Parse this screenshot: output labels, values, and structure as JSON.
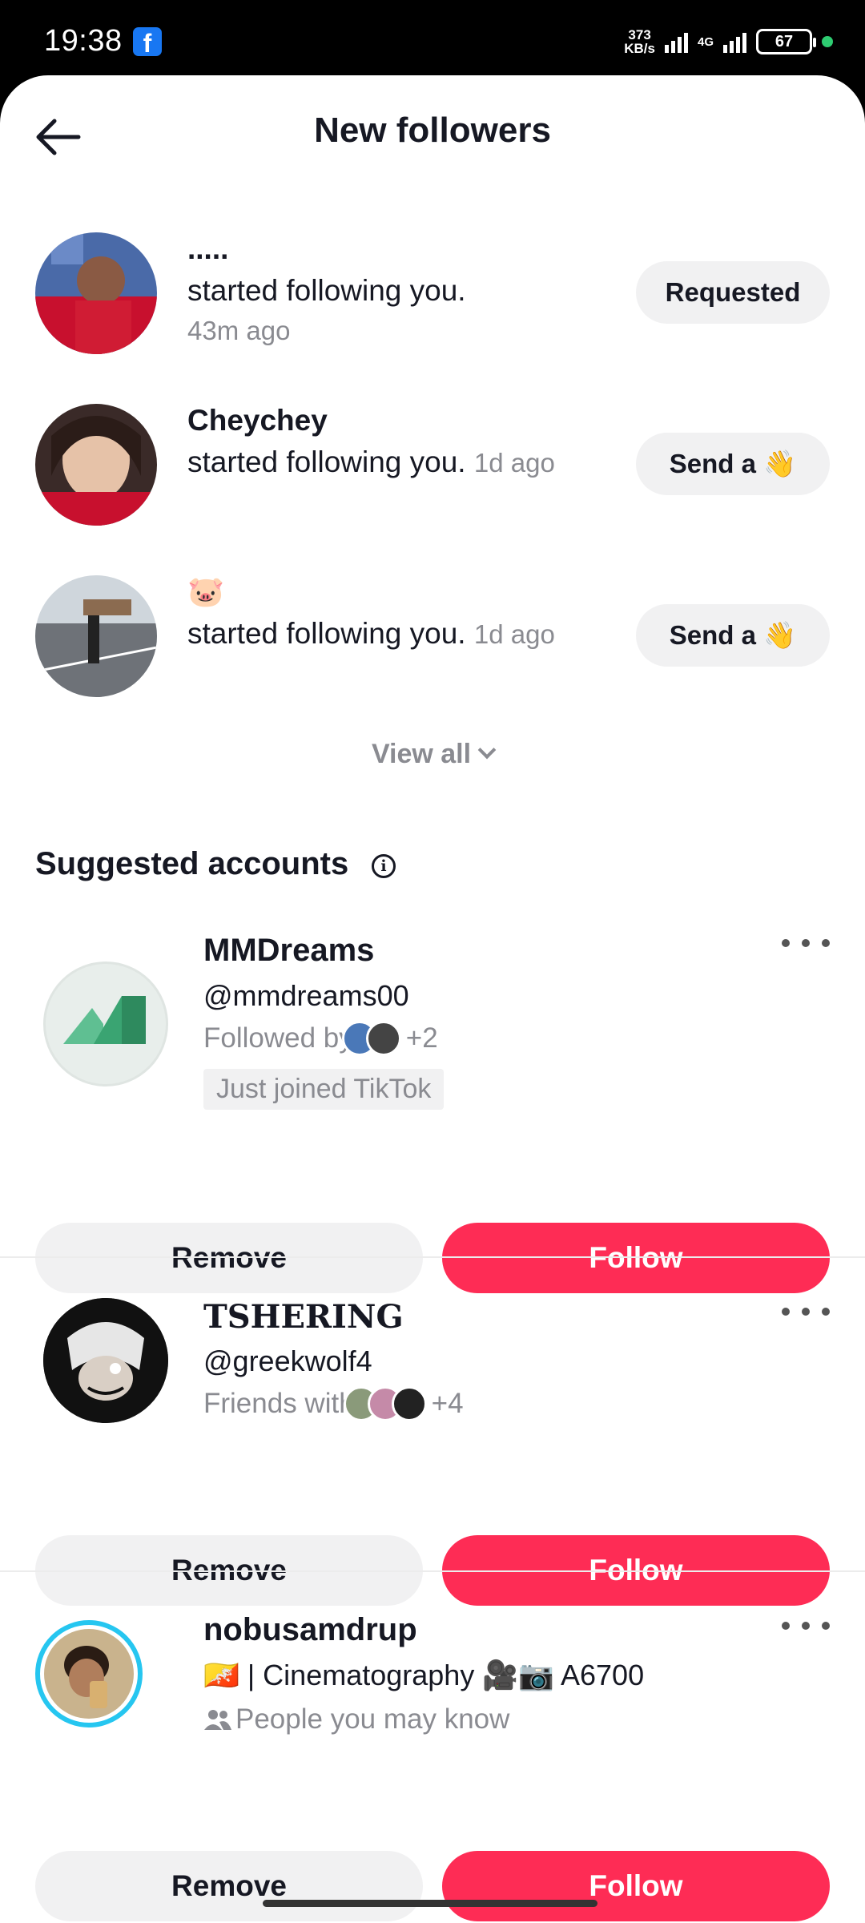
{
  "status_bar": {
    "time": "19:38",
    "fb_icon": "f",
    "speed_value": "373",
    "speed_unit": "KB/s",
    "network": "4G",
    "battery": "67"
  },
  "header": {
    "title": "New followers",
    "back_icon": "back-arrow-icon"
  },
  "followers": [
    {
      "name": ".....",
      "text": "started following you.",
      "time": "43m ago",
      "button": "Requested"
    },
    {
      "name": "Cheychey",
      "text": "started following you.",
      "time": "1d ago",
      "button": "Send a 👋"
    },
    {
      "name": "🐷",
      "text": "started following you.",
      "time": "1d ago",
      "button": "Send a 👋"
    }
  ],
  "view_all": "View all",
  "suggested": {
    "title": "Suggested accounts",
    "accounts": [
      {
        "name": "MMDreams",
        "handle": "@mmdreams00",
        "meta_label": "Followed by",
        "meta_count": "+2",
        "tag": "Just joined TikTok",
        "remove": "Remove",
        "follow": "Follow"
      },
      {
        "name": "TSHERING",
        "handle": "@greekwolf4",
        "meta_label": "Friends with",
        "meta_count": "+4",
        "remove": "Remove",
        "follow": "Follow"
      },
      {
        "name": "nobusamdrup",
        "bio": "🇧🇹 | Cinematography 🎥📷 A6700",
        "meta_label": "People you may know",
        "remove": "Remove",
        "follow": "Follow"
      }
    ]
  },
  "colors": {
    "follow": "#fe2c55",
    "pill": "#f1f1f2",
    "muted": "#8a8b91"
  }
}
